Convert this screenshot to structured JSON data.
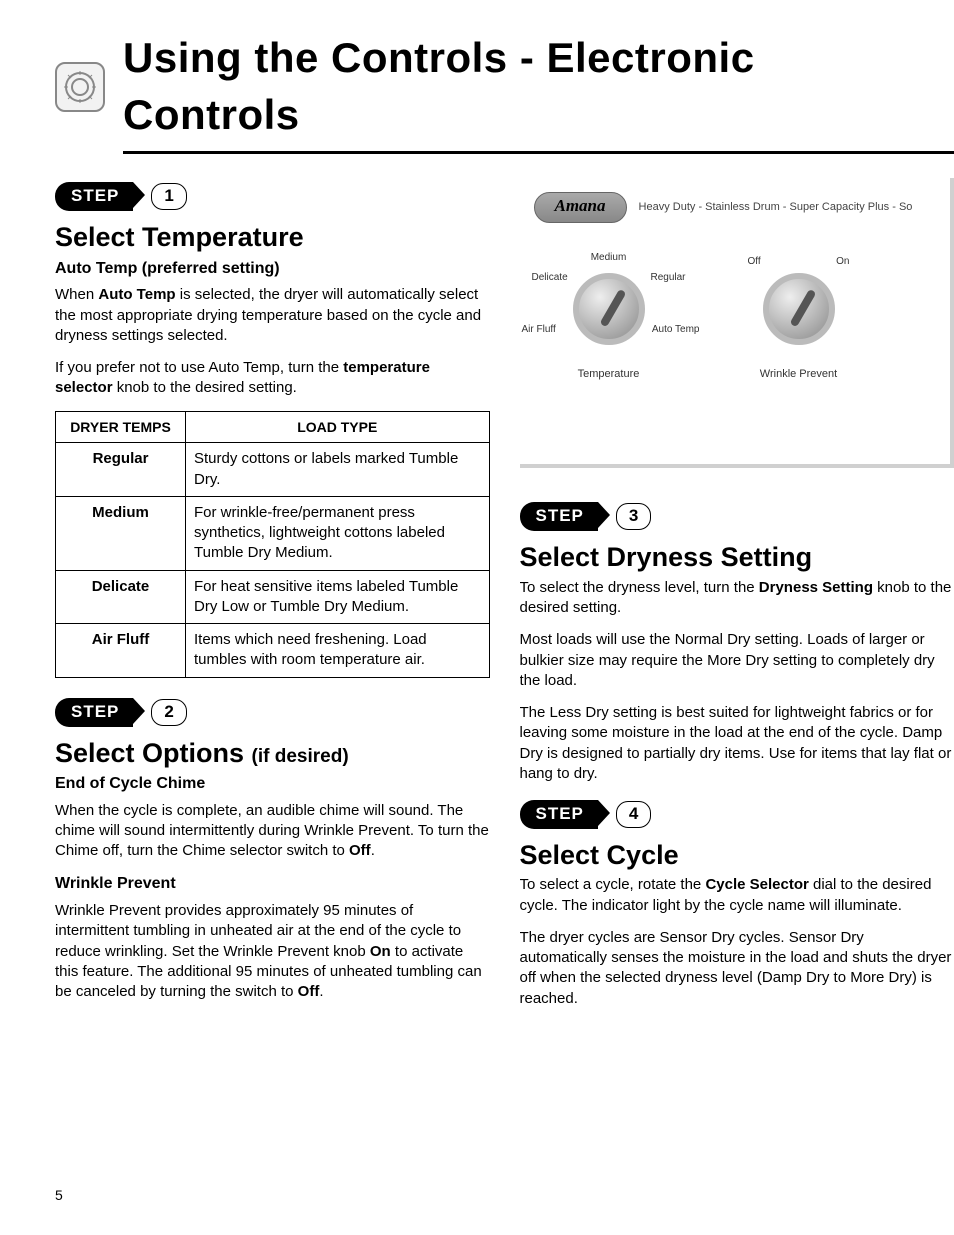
{
  "page_title": "Using the Controls - Electronic Controls",
  "page_number": "5",
  "steps": {
    "label": "STEP",
    "s1": "1",
    "s2": "2",
    "s3": "3",
    "s4": "4"
  },
  "section1": {
    "heading": "Select Temperature",
    "sub": "Auto Temp (preferred setting)",
    "p1_a": "When ",
    "p1_b": "Auto Temp",
    "p1_c": " is selected, the dryer will automatically select the most appropriate drying temperature based on the cycle and dryness settings selected.",
    "p2_a": "If you prefer not to use Auto Temp, turn the ",
    "p2_b": "temperature selector",
    "p2_c": " knob to the desired setting.",
    "table": {
      "h1": "DRYER TEMPS",
      "h2": "LOAD TYPE",
      "rows": [
        {
          "temp": "Regular",
          "load": "Sturdy cottons or labels marked Tumble Dry."
        },
        {
          "temp": "Medium",
          "load": "For wrinkle-free/permanent press synthetics, lightweight cottons labeled Tumble Dry Medium."
        },
        {
          "temp": "Delicate",
          "load": "For heat sensitive items labeled Tumble Dry Low or Tumble Dry Medium."
        },
        {
          "temp": "Air Fluff",
          "load": "Items which need freshening. Load tumbles with room temperature air."
        }
      ]
    }
  },
  "section2": {
    "heading": "Select Options ",
    "heading_paren": "(if desired)",
    "sub1": "End of Cycle Chime",
    "p1_a": "When the cycle is complete, an audible chime will sound. The chime will sound intermittently during Wrinkle Prevent. To turn the Chime off, turn the Chime selector switch to ",
    "p1_b": "Off",
    "p1_c": ".",
    "sub2": "Wrinkle Prevent",
    "p2_a": "Wrinkle Prevent provides approximately 95 minutes of intermittent tumbling in unheated air at the end of the cycle to reduce wrinkling.  Set the Wrinkle Prevent knob ",
    "p2_b": "On",
    "p2_c": " to activate this feature. The additional 95 minutes of unheated tumbling can be canceled by turning the switch to ",
    "p2_d": "Off",
    "p2_e": "."
  },
  "section3": {
    "heading": "Select Dryness Setting",
    "p1_a": "To select the dryness level, turn the ",
    "p1_b": "Dryness Setting",
    "p1_c": " knob to the desired setting.",
    "p2": "Most loads will use the Normal Dry setting. Loads of larger or bulkier size may require the More Dry setting to completely dry the load.",
    "p3": "The Less Dry setting is best suited for lightweight fabrics or for leaving some moisture in the load at the end of the cycle. Damp Dry is designed to partially dry items. Use for items that lay flat or hang to dry."
  },
  "section4": {
    "heading": "Select Cycle",
    "p1_a": "To select a cycle, rotate the ",
    "p1_b": "Cycle Selector",
    "p1_c": " dial to the desired cycle. The indicator light by the cycle name will illuminate.",
    "p2": "The dryer cycles are Sensor Dry cycles. Sensor Dry automatically senses the moisture in the load and shuts the dryer off when the selected dryness level (Damp Dry to More Dry) is reached."
  },
  "panel": {
    "brand": "Amana",
    "subtitle": "Heavy Duty - Stainless Drum - Super Capacity Plus - So",
    "knob1": {
      "label": "Temperature",
      "ticks": {
        "top": "Medium",
        "tl": "Delicate",
        "tr": "Regular",
        "bl": "Air Fluff",
        "br": "Auto Temp"
      }
    },
    "knob2": {
      "label": "Wrinkle Prevent",
      "ticks": {
        "l": "Off",
        "r": "On"
      }
    }
  }
}
